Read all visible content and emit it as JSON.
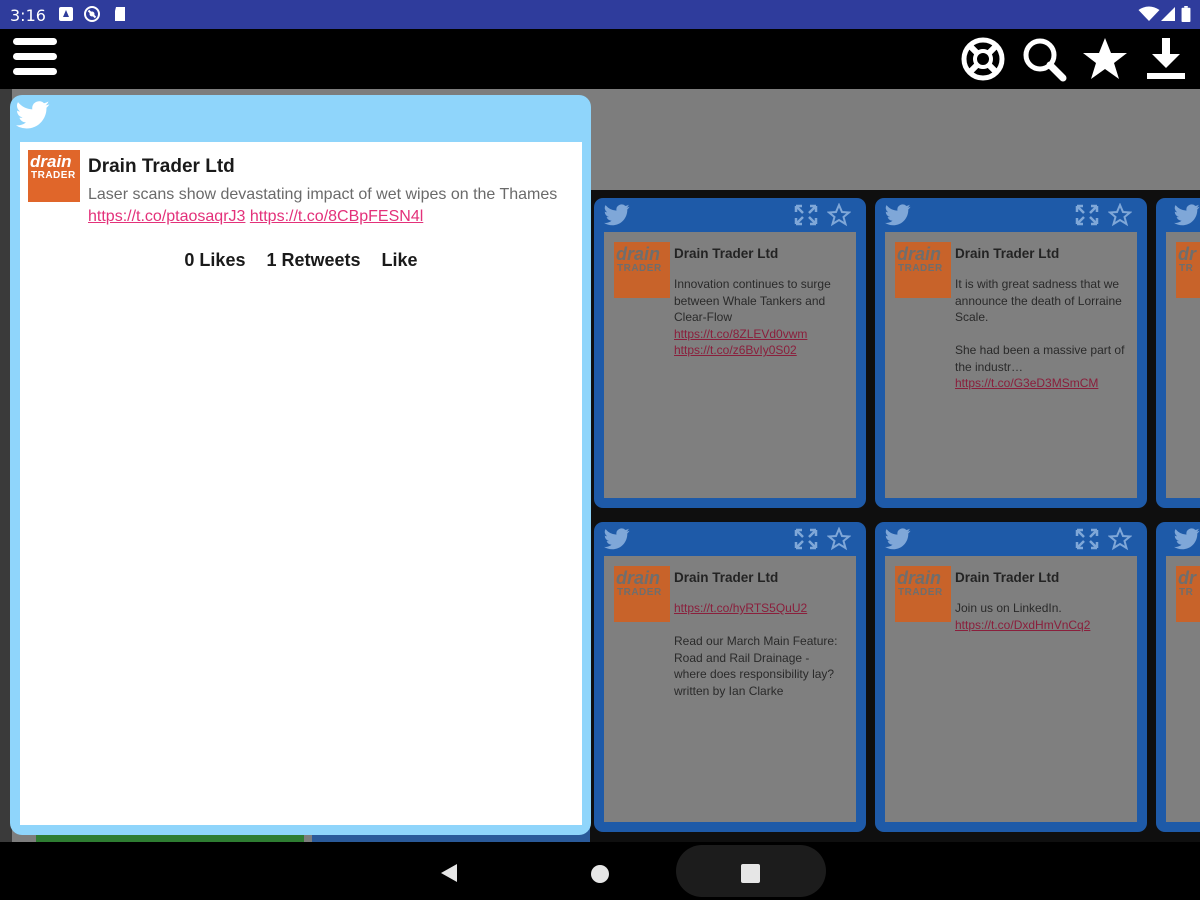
{
  "status_bar": {
    "time": "3:16",
    "icons": [
      "notification-icon",
      "vpn-icon",
      "sd-card-icon"
    ],
    "right_icons": [
      "wifi-icon",
      "signal-icon",
      "battery-icon"
    ]
  },
  "app_bar": {
    "icons": [
      "menu-icon",
      "help-lifebuoy-icon",
      "search-icon",
      "star-icon",
      "download-icon"
    ]
  },
  "expanded_tweet": {
    "author": "Drain Trader Ltd",
    "logo": {
      "line1": "drain",
      "line2": "TRADER"
    },
    "text_prefix": "Laser scans show devastating impact of wet wipes on the Thames ",
    "link1": "https://t.co/ptaosaqrJ3",
    "link2": "https://t.co/8CBpFESN4l",
    "likes": "0 Likes",
    "retweets": "1 Retweets",
    "like_action": "Like"
  },
  "cards": [
    {
      "author": "Drain Trader Ltd",
      "logo": {
        "line1": "drain",
        "line2": "TRADER"
      },
      "para1": "Innovation continues to surge between Whale Tankers and Clear-Flow",
      "link1": "https://t.co/8ZLEVd0vwm",
      "link2": "https://t.co/z6BvIy0S02"
    },
    {
      "author": "Drain Trader Ltd",
      "logo": {
        "line1": "drain",
        "line2": "TRADER"
      },
      "para1": "It is with great sadness that we announce the death of Lorraine Scale.",
      "para2": "She had been a massive part of the industr… ",
      "link1": "https://t.co/G3eD3MSmCM"
    },
    {
      "author": "Drain Trader Ltd",
      "logo": {
        "line1": "drain",
        "line2": "TRADER"
      },
      "link1": "https://t.co/hyRTS5QuU2",
      "para2": "Read our March Main Feature: Road and Rail Drainage - where does responsibility lay? written by Ian Clarke"
    },
    {
      "author": "Drain Trader Ltd",
      "logo": {
        "line1": "drain",
        "line2": "TRADER"
      },
      "para1": "Join us on LinkedIn. ",
      "link1": "https://t.co/DxdHmVnCq2"
    }
  ],
  "partial_cards": [
    {
      "logo": {
        "line1": "dr",
        "line2": "TR"
      }
    },
    {
      "logo": {
        "line1": "dr",
        "line2": "TR"
      }
    }
  ],
  "colors": {
    "status_bar": "#2f3c9c",
    "card_frame": "#1e5aa8",
    "expanded_frame": "#8fd5fb",
    "link": "#e3317a",
    "logo_orange": "#e0662a"
  }
}
